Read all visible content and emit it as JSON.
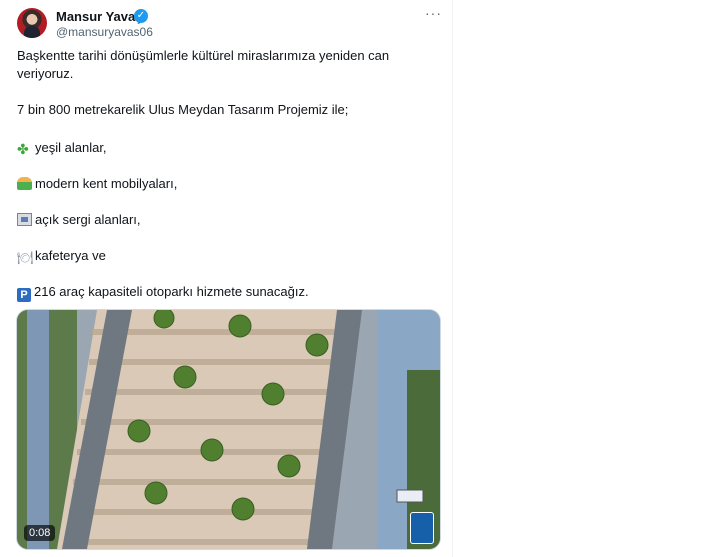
{
  "author": {
    "name": "Mansur Yavaş",
    "handle": "@mansuryavas06",
    "verified_icon": "verified-badge-icon",
    "accent_color": "#1d9bf0"
  },
  "post": {
    "paragraph1": "Başkentte tarihi dönüşümlerle kültürel miraslarımıza yeniden can veriyoruz.",
    "paragraph2": "7 bin 800 metrekarelik Ulus Meydan Tasarım Projemiz ile;",
    "items": [
      {
        "icon": "four-leaf-clover-icon",
        "text": "yeşil alanlar,"
      },
      {
        "icon": "park-bench-icon",
        "text": "modern kent mobilyaları,"
      },
      {
        "icon": "framed-picture-icon",
        "text": "açık sergi alanları,"
      },
      {
        "icon": "fork-and-knife-icon",
        "text": "kafeterya ve"
      },
      {
        "icon": "parking-icon",
        "text": "216 araç kapasiteli otoparkı hizmete sunacağız."
      }
    ]
  },
  "media": {
    "type": "video",
    "duration": "0:08",
    "description_icon": "ankara-municipality-logo-icon"
  },
  "menu": {
    "more_icon": "more-options-icon",
    "more_label": "···"
  }
}
